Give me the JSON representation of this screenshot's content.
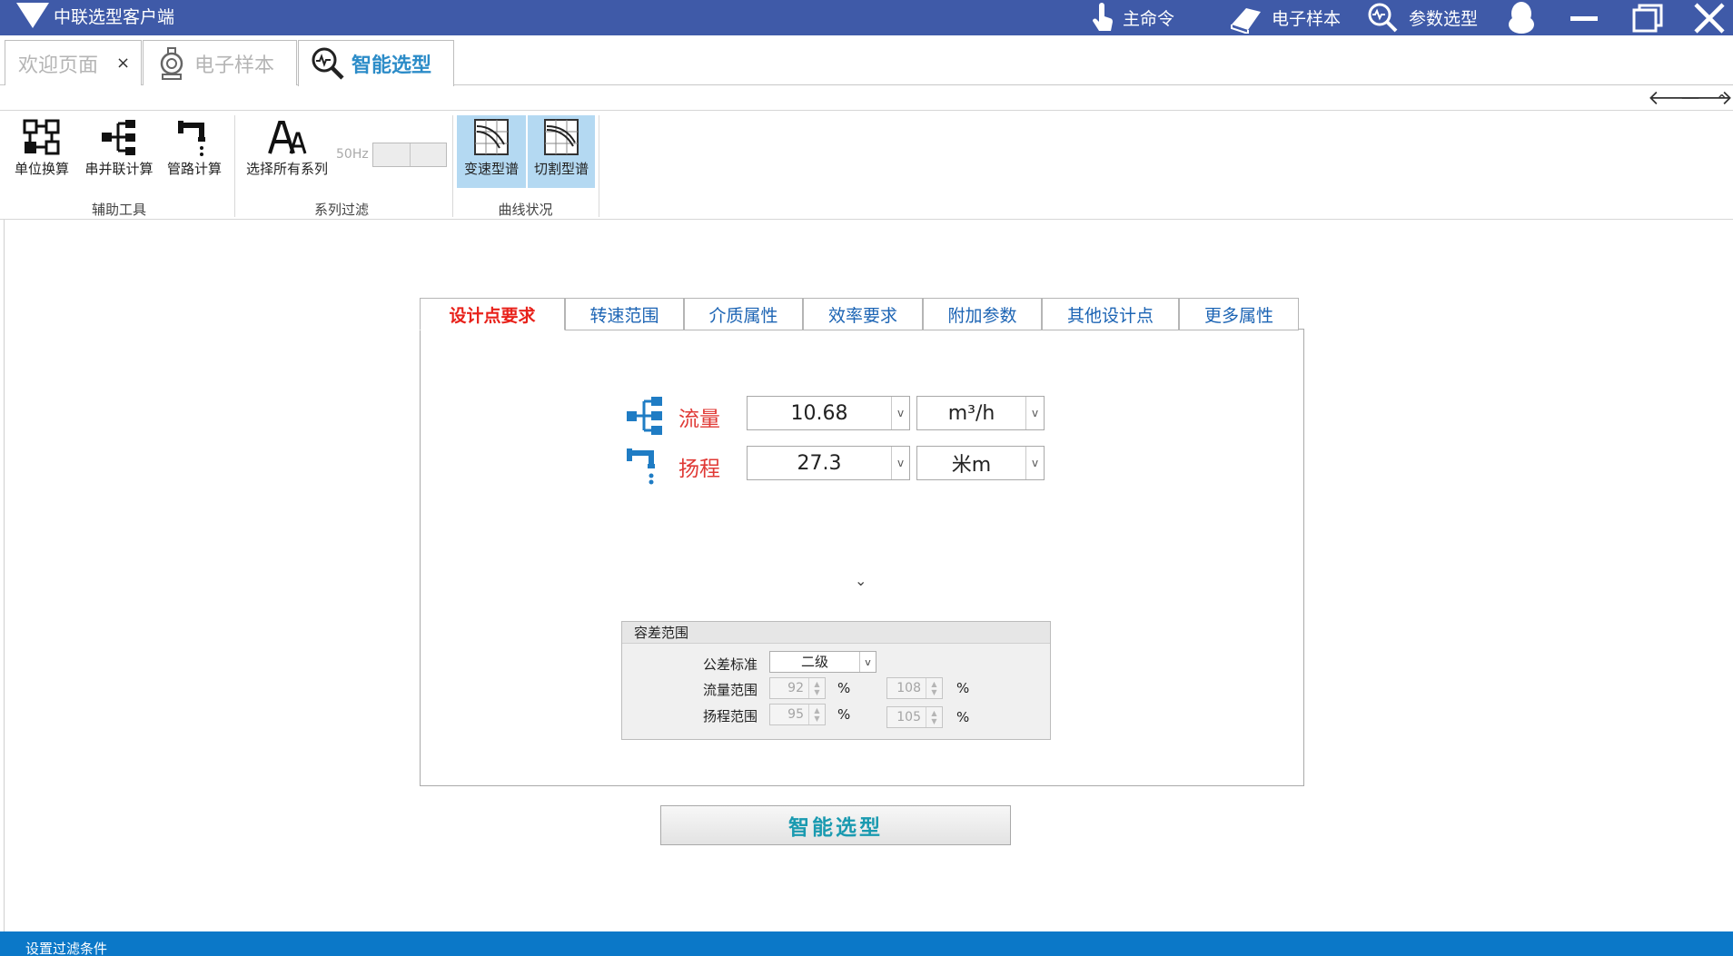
{
  "titlebar": {
    "app_title": "中联选型客户端",
    "buttons": [
      {
        "label": "主命令",
        "icon": "hand-pointer-icon"
      },
      {
        "label": "电子样本",
        "icon": "book-icon"
      },
      {
        "label": "参数选型",
        "icon": "search-chart-icon"
      }
    ],
    "window_controls": [
      "qq-icon",
      "minimize-icon",
      "restore-icon",
      "close-icon"
    ]
  },
  "doc_tabs": [
    {
      "label": "欢迎页面",
      "close": "×",
      "active": false
    },
    {
      "label": "电子样本",
      "icon": "pump-icon",
      "active": false
    },
    {
      "label": "智能选型",
      "icon": "search-chart-icon",
      "active": true
    }
  ],
  "nav": {
    "back": "🡐",
    "forward": "🡒",
    "collapse": "^"
  },
  "ribbon": {
    "groups": [
      {
        "label": "辅助工具",
        "buttons": [
          "单位换算",
          "串并联计算",
          "管路计算"
        ]
      },
      {
        "label": "系列过滤",
        "buttons": [
          "选择所有系列"
        ],
        "toggle_label": "50Hz"
      },
      {
        "label": "曲线状况",
        "buttons": [
          "变速型谱",
          "切割型谱"
        ]
      }
    ]
  },
  "content_tabs": [
    "设计点要求",
    "转速范围",
    "介质属性",
    "效率要求",
    "附加参数",
    "其他设计点",
    "更多属性"
  ],
  "design_point": {
    "flow": {
      "label": "流量",
      "value": "10.68",
      "unit": "m³/h"
    },
    "head": {
      "label": "扬程",
      "value": "27.3",
      "unit": "米m"
    }
  },
  "expand": "⌄",
  "tolerance": {
    "title": "容差范围",
    "standard_label": "公差标准",
    "standard_value": "二级",
    "flow_label": "流量范围",
    "flow_min": "92",
    "flow_max": "108",
    "head_label": "扬程范围",
    "head_min": "95",
    "head_max": "105",
    "percent": "%"
  },
  "action_button": "智能选型",
  "status": "设置过滤条件",
  "colors": {
    "titlebar": "#3f5aa8",
    "statusbar": "#0b78c8",
    "active_tab_text": "#e8211a",
    "tab_text": "#1c64b4",
    "field_label": "#e03a36",
    "action_text": "#1a9ab0"
  }
}
